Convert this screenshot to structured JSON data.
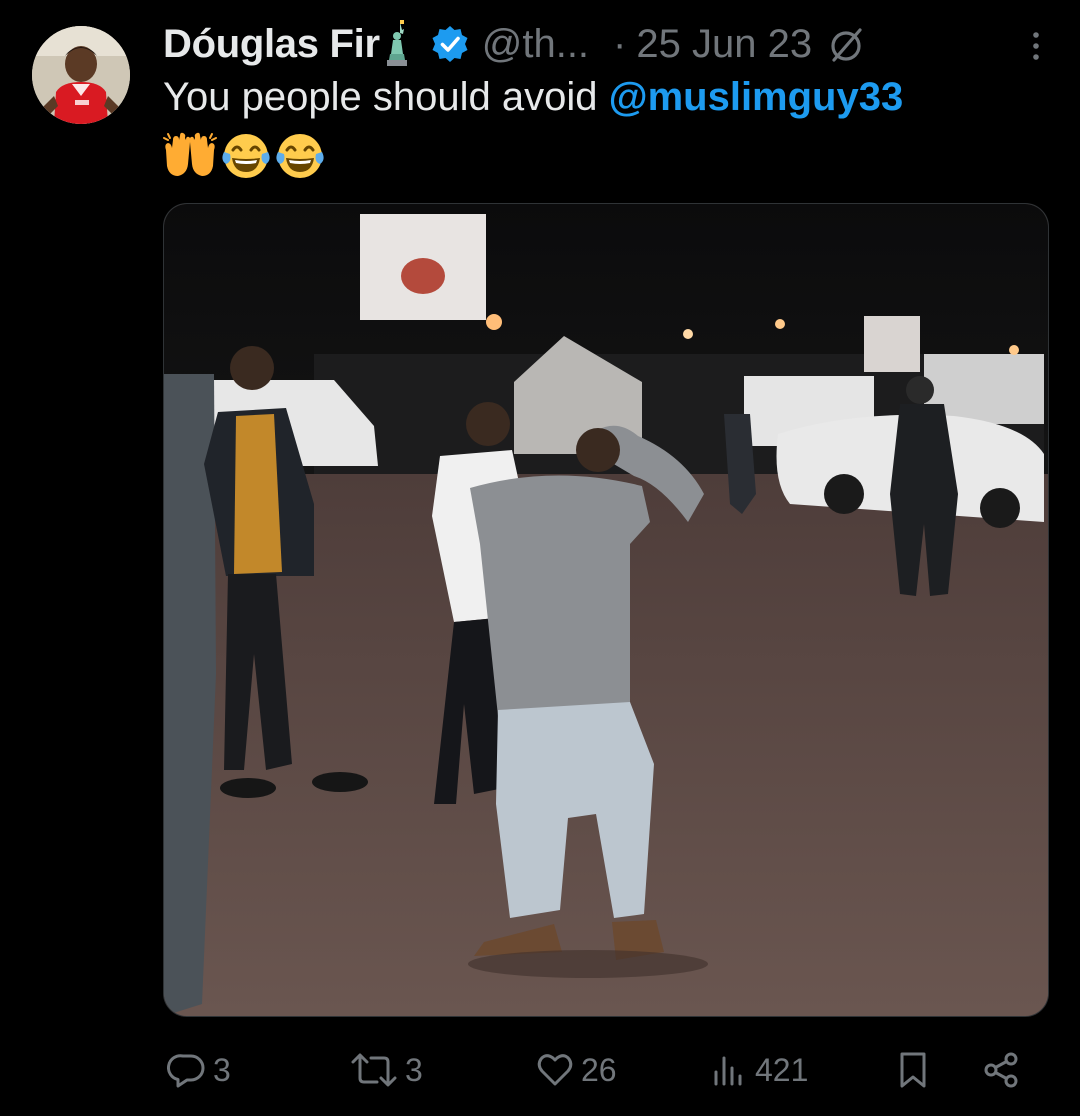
{
  "tweet": {
    "author": {
      "display_name": "Dóuglas Fir",
      "name_emoji": "statue-of-liberty",
      "verified": true,
      "handle": "@th...",
      "avatar": "profile-photo"
    },
    "separator": "·",
    "date": "25 Jun 23",
    "text_before_mention": "You people should avoid ",
    "mention": "@muslimguy33",
    "emojis": [
      "raising-hands",
      "face-with-tears-of-joy",
      "face-with-tears-of-joy"
    ],
    "media": {
      "type": "photo",
      "description_icon": "image"
    },
    "stats": {
      "replies": "3",
      "reposts": "3",
      "likes": "26",
      "views": "421"
    }
  },
  "colors": {
    "background": "#000000",
    "text": "#e7e9ea",
    "secondary": "#71767b",
    "link": "#1d9bf0",
    "verified_badge": "#1d9bf0"
  },
  "icons": {
    "reply": "reply-icon",
    "repost": "repost-icon",
    "like": "heart-icon",
    "views": "views-icon",
    "bookmark": "bookmark-icon",
    "share": "share-icon",
    "more": "more-icon",
    "muted": "no-entry-icon"
  }
}
